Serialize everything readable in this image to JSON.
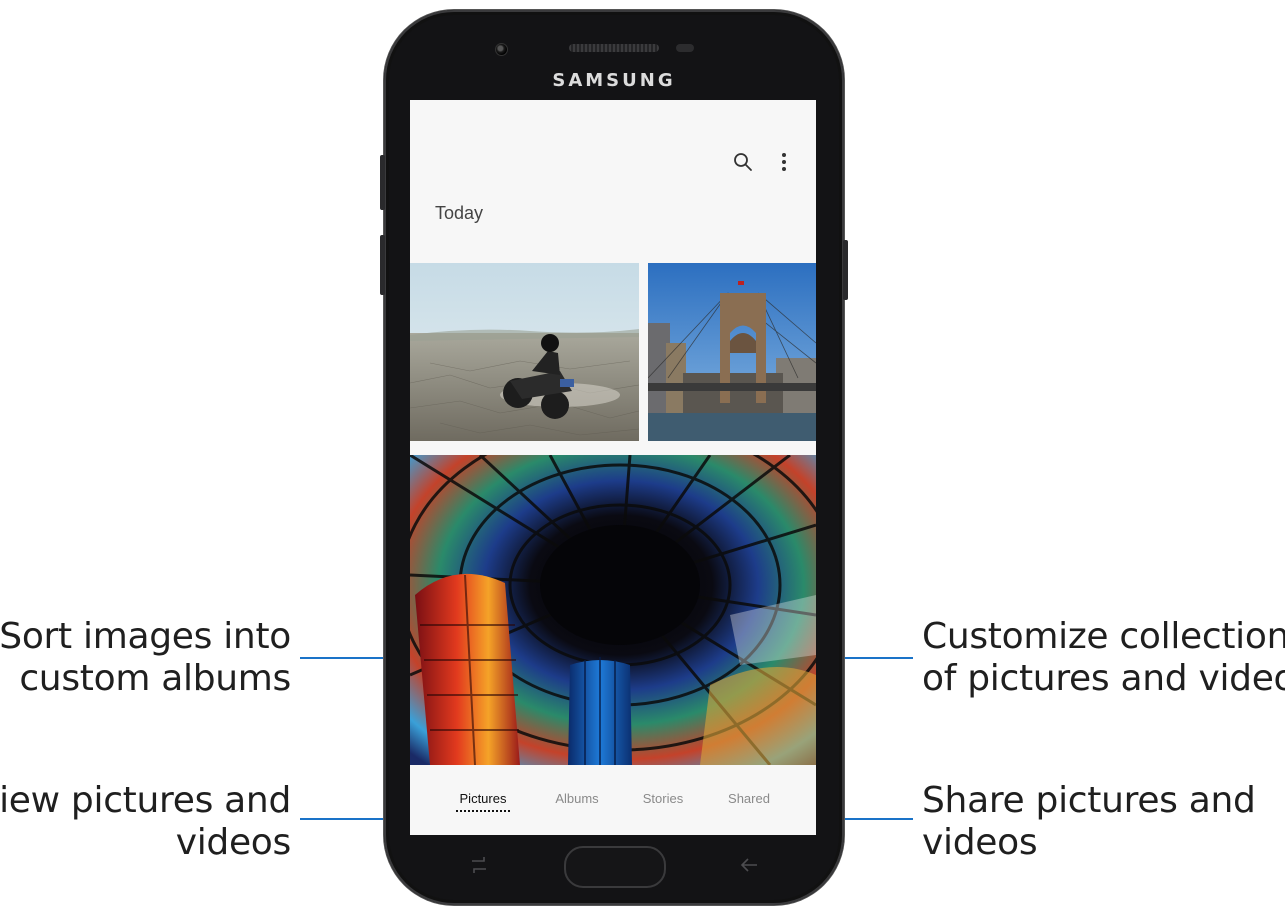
{
  "callouts": {
    "albums": [
      "Sort images into",
      "custom albums"
    ],
    "pictures": [
      "View pictures and",
      "videos"
    ],
    "stories": [
      "Customize collections",
      "of pictures and videos"
    ],
    "shared": [
      "Share pictures and",
      "videos"
    ]
  },
  "device": {
    "brand": "SAMSUNG"
  },
  "gallery": {
    "section_title": "Today",
    "icons": {
      "search": "search-icon",
      "more": "more-options-icon"
    }
  },
  "tabs": [
    {
      "label": "Pictures",
      "active": true
    },
    {
      "label": "Albums",
      "active": false
    },
    {
      "label": "Stories",
      "active": false
    },
    {
      "label": "Shared",
      "active": false
    }
  ],
  "colors": {
    "leader": "#1a73c8",
    "phone_body": "#131315",
    "screen_bg": "#f7f7f7"
  }
}
